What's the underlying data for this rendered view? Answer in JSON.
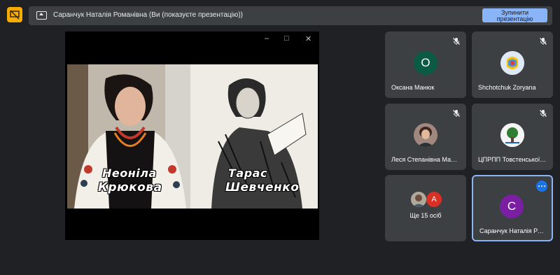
{
  "banner": {
    "text": "Саранчук Наталія Романівна (Ви (показуєте презентацію))",
    "stop_button": "Зупинити презентацію"
  },
  "slide": {
    "left_caption_line1": "Неоніла",
    "left_caption_line2": "Крюкова",
    "right_caption_line1": "Тарас",
    "right_caption_line2": "Шевченко"
  },
  "window_controls": [
    "–",
    "□",
    "✕"
  ],
  "participants": [
    {
      "name": "Оксана Манюк",
      "initial": "О",
      "color": "#0b5a43",
      "muted": true
    },
    {
      "name": "Shchotchuk Zoryana",
      "initial": "",
      "muted": true
    },
    {
      "name": "Леся Степанівна Мацько",
      "initial": "",
      "muted": true
    },
    {
      "name": "ЦПРПП Товстенської ОТГ",
      "initial": "",
      "muted": true
    },
    {
      "name": "Ще 15 осіб",
      "initial": "А",
      "color": "#d93025"
    },
    {
      "name": "Саранчук Наталія Романівна",
      "initial": "С",
      "color": "#7b1fa2"
    }
  ]
}
